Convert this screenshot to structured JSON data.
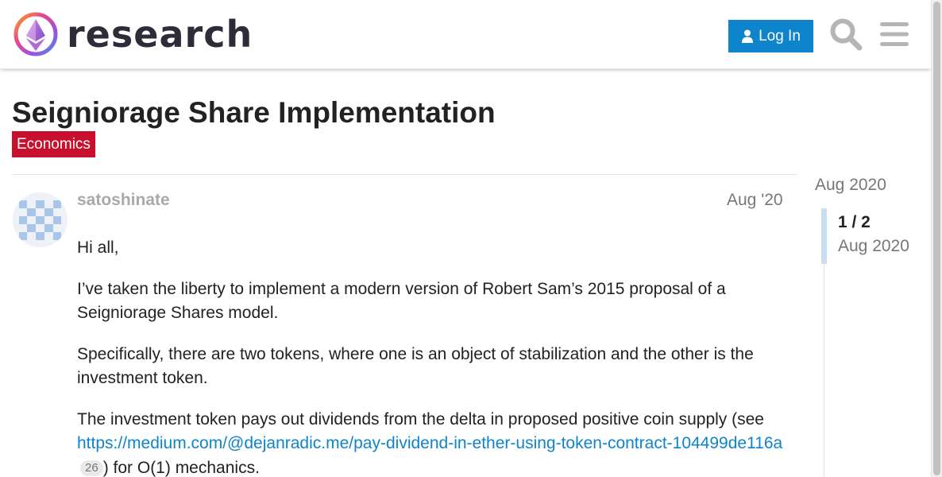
{
  "header": {
    "logo_text": "research",
    "login_label": "Log In",
    "search_icon": "search-icon",
    "menu_icon": "hamburger-menu-icon"
  },
  "topic": {
    "title": "Seigniorage Share Implementation",
    "category": "Economics",
    "category_color": "#c8102e"
  },
  "post": {
    "username": "satoshinate",
    "date": "Aug '20",
    "paragraph1": "Hi all,",
    "paragraph2": "I’ve taken the liberty to implement a modern version of Robert Sam’s 2015 proposal of a Seigniorage Shares model.",
    "paragraph3": "Specifically, there are two tokens, where one is an object of stabilization and the other is the investment token.",
    "paragraph4_prefix": "The investment token pays out dividends from the delta in proposed positive coin supply (see ",
    "paragraph4_link": "https://medium.com/@dejanradic.me/pay-dividend-in-ether-using-token-contract-104499de116a",
    "paragraph4_link_clicks": "26",
    "paragraph4_suffix": ") for O(1) mechanics."
  },
  "timeline": {
    "start_date": "Aug 2020",
    "position": "1 / 2",
    "current_date": "Aug 2020"
  },
  "colors": {
    "accent": "#0e84cc",
    "link": "#0e84cc"
  }
}
